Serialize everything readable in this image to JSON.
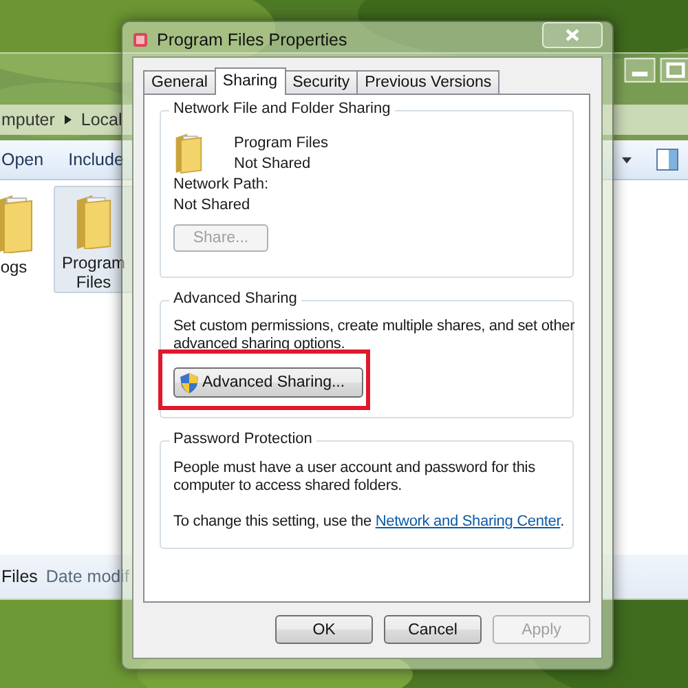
{
  "explorer": {
    "breadcrumb": [
      {
        "label": "mputer"
      },
      {
        "label": "Local"
      }
    ],
    "toolbar": [
      {
        "label": "Open"
      },
      {
        "label": "Include"
      }
    ],
    "items": [
      {
        "label": "ogs",
        "selected": false
      },
      {
        "label": "Program Files",
        "selected": true
      }
    ],
    "details": {
      "name": "Files",
      "field": "Date modif"
    }
  },
  "dialog": {
    "title": "Program Files Properties",
    "tabs": [
      {
        "label": "General",
        "selected": false
      },
      {
        "label": "Sharing",
        "selected": true
      },
      {
        "label": "Security",
        "selected": false
      },
      {
        "label": "Previous Versions",
        "selected": false
      }
    ],
    "network_sharing": {
      "title": "Network File and Folder Sharing",
      "folder_name": "Program Files",
      "folder_status": "Not Shared",
      "path_label": "Network Path:",
      "path_value": "Not Shared",
      "button": {
        "label": "Share...",
        "disabled": true
      }
    },
    "advanced_sharing": {
      "title": "Advanced Sharing",
      "description": "Set custom permissions, create multiple shares, and set other advanced sharing options.",
      "button": {
        "label": "Advanced Sharing...",
        "highlighted": true
      }
    },
    "password_protection": {
      "title": "Password Protection",
      "description": "People must have a user account and password for this computer to access shared folders.",
      "hint_before": "To change this setting, use the ",
      "link": "Network and Sharing Center",
      "hint_after": "."
    },
    "buttons": [
      {
        "label": "OK",
        "disabled": false
      },
      {
        "label": "Cancel",
        "disabled": false
      },
      {
        "label": "Apply",
        "disabled": true
      }
    ]
  }
}
